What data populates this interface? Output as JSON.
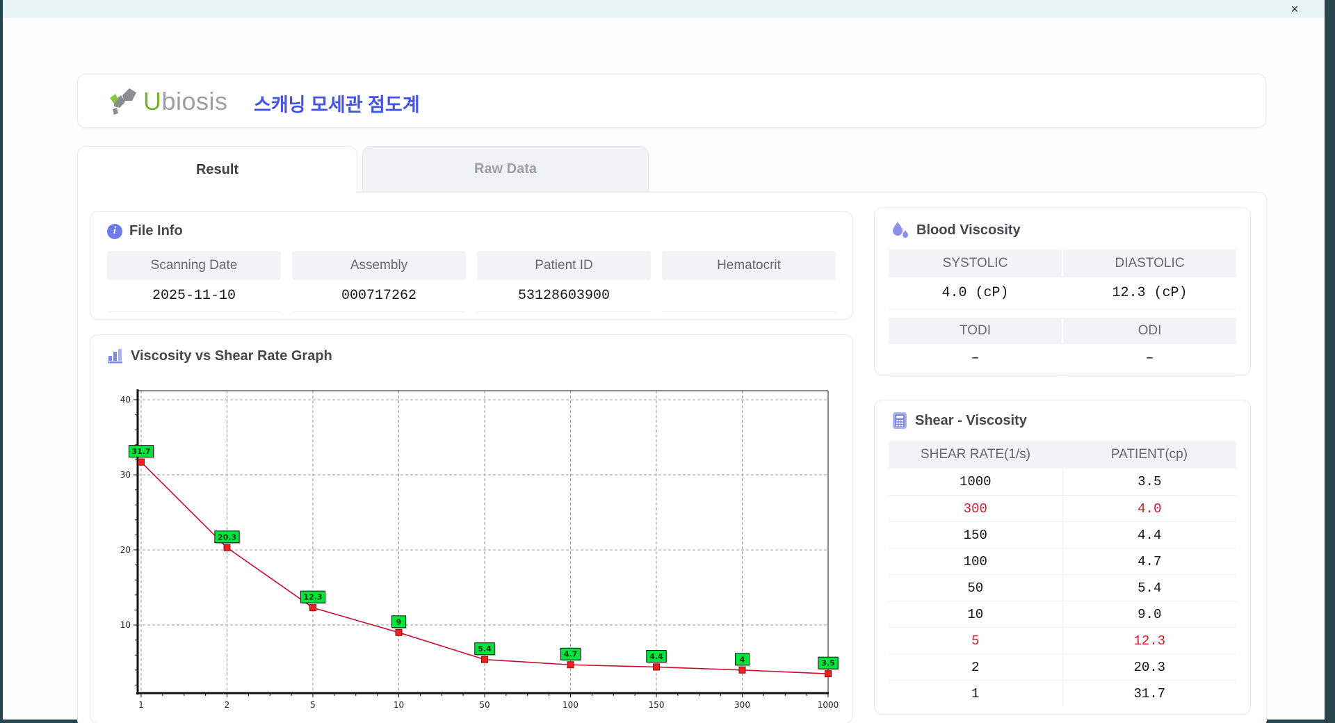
{
  "window": {
    "close_icon": "×"
  },
  "header": {
    "logo_u": "U",
    "logo_rest": "biosis",
    "title_ko": "스캐닝 모세관 점도계",
    "logo_green": "#7ab32a",
    "logo_gray": "#9c9ea1",
    "title_color": "#4353e6"
  },
  "tabs": [
    {
      "label": "Result",
      "active": true
    },
    {
      "label": "Raw Data",
      "active": false
    }
  ],
  "file_info": {
    "title": "File Info",
    "fields": [
      {
        "label": "Scanning Date",
        "value": "2025-11-10"
      },
      {
        "label": "Assembly",
        "value": "000717262"
      },
      {
        "label": "Patient ID",
        "value": "53128603900"
      },
      {
        "label": "Hematocrit",
        "value": ""
      }
    ]
  },
  "blood_viscosity": {
    "title": "Blood Viscosity",
    "row1": [
      {
        "label": "SYSTOLIC",
        "value": "4.0 (cP)"
      },
      {
        "label": "DIASTOLIC",
        "value": "12.3 (cP)"
      }
    ],
    "row2": [
      {
        "label": "TODI",
        "value": "–"
      },
      {
        "label": "ODI",
        "value": "–"
      }
    ]
  },
  "graph_section": {
    "title": "Viscosity vs Shear Rate Graph"
  },
  "chart_data": {
    "type": "line",
    "title": "Viscosity vs Shear Rate Graph",
    "x_categories": [
      "1",
      "2",
      "5",
      "10",
      "50",
      "100",
      "150",
      "300",
      "1000"
    ],
    "series": [
      {
        "name": "PATIENT(cp)",
        "values": [
          31.7,
          20.3,
          12.3,
          9,
          5.4,
          4.7,
          4.4,
          4,
          3.5
        ]
      }
    ],
    "point_labels": [
      "31.7",
      "20.3",
      "12.3",
      "9",
      "5.4",
      "4.7",
      "4.4",
      "4",
      "3.5"
    ],
    "y_ticks": [
      10,
      20,
      30,
      40
    ],
    "ylim": [
      0,
      42
    ],
    "x_axis_type": "category-spaced-evenly",
    "grid": "dashed",
    "legend": "none",
    "line_color": "#c8102e",
    "marker_color": "#f01f1f",
    "marker_border": "#8d0f0f",
    "label_bg": "#00e53e",
    "label_border": "#111111",
    "label_text_color": "#053800",
    "grid_color": "#9b9b9b",
    "axis_color": "#111111"
  },
  "shear_viscosity": {
    "title": "Shear - Viscosity",
    "columns": [
      "SHEAR RATE(1/s)",
      "PATIENT(cp)"
    ],
    "highlight_color": "#d01c2e",
    "rows": [
      {
        "shear": "1000",
        "patient": "3.5",
        "highlight": false
      },
      {
        "shear": "300",
        "patient": "4.0",
        "highlight": true
      },
      {
        "shear": "150",
        "patient": "4.4",
        "highlight": false
      },
      {
        "shear": "100",
        "patient": "4.7",
        "highlight": false
      },
      {
        "shear": "50",
        "patient": "5.4",
        "highlight": false
      },
      {
        "shear": "10",
        "patient": "9.0",
        "highlight": false
      },
      {
        "shear": "5",
        "patient": "12.3",
        "highlight": true
      },
      {
        "shear": "2",
        "patient": "20.3",
        "highlight": false
      },
      {
        "shear": "1",
        "patient": "31.7",
        "highlight": false
      }
    ]
  }
}
